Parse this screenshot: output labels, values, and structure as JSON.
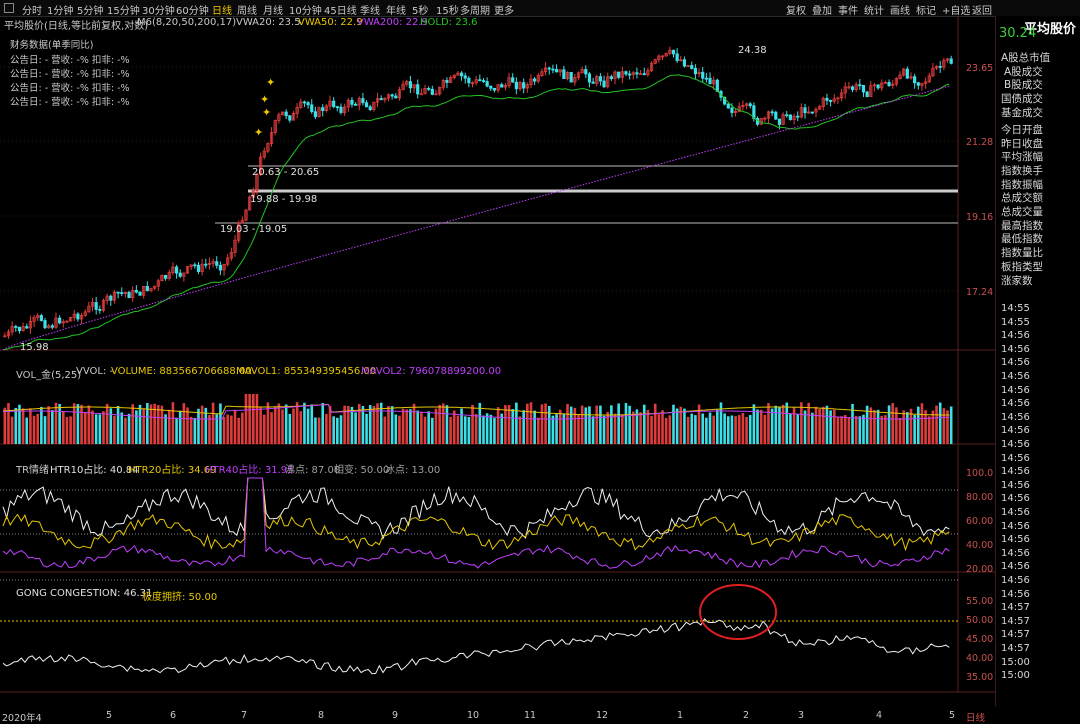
{
  "toolbar": {
    "periods": [
      "分时",
      "1分钟",
      "5分钟",
      "15分钟",
      "30分钟",
      "60分钟",
      "日线",
      "周线",
      "月线",
      "10分钟",
      "45日线",
      "季线",
      "年线",
      "5秒",
      "15秒",
      "多周期",
      "更多"
    ],
    "active": "日线",
    "right": [
      "复权",
      "叠加",
      "事件",
      "统计",
      "画线",
      "标记",
      "+自选",
      "返回"
    ]
  },
  "main": {
    "title": "平均股价(日线,等比前复权,对数)",
    "ma_label": "M6(8,20,50,200,17)",
    "vwa20": "VWA20: 23.5",
    "vwa50": "VWA50: 22.9",
    "vwa200": "VWA200: 22.9",
    "hold": "HOLD: 23.6",
    "finance_header": "财务数据(单季同比)",
    "finance_rows": [
      "公告日: -   营收: -%   扣非: -%",
      "公告日: -   营收: -%   扣非: -%",
      "公告日: -   营收: -%   扣非: -%",
      "公告日: -   营收: -%   扣非: -%"
    ],
    "price_levels": [
      "23.65",
      "21.28",
      "19.16",
      "17.24"
    ],
    "high_label": "24.38",
    "low_label": "15.98",
    "zones": [
      "20.63 - 20.65",
      "19.88 - 19.98",
      "19.03 - 19.05"
    ]
  },
  "volume": {
    "title": "VOL_金(5,25)",
    "vvol": "VVOL: -",
    "volume": "VOLUME: 883566706688.00",
    "mavol1": "MAVOL1: 855349395456.00",
    "mavol2": "MAVOL2: 796078899200.00"
  },
  "tr": {
    "title": "TR情绪",
    "htr10": "HTR10占比: 40.84",
    "htr20": "HTR20占比: 34.69",
    "htr40": "HTR40占比: 31.95",
    "boil": "沸点: 87.00",
    "phase": "相变: 50.00",
    "freeze": "冰点: 13.00",
    "levels": [
      "100.0",
      "80.00",
      "60.00",
      "40.00",
      "20.00"
    ]
  },
  "gong": {
    "title": "GONG CONGESTION: 46.31",
    "extreme": "极度拥挤: 50.00",
    "levels": [
      "55.00",
      "50.00",
      "45.00",
      "40.00",
      "35.00"
    ]
  },
  "xaxis": [
    "2020年4",
    "5",
    "6",
    "7",
    "8",
    "9",
    "10",
    "11",
    "12",
    "1",
    "2",
    "3",
    "4",
    "5"
  ],
  "xaxis_end": "日线",
  "right_panel": {
    "title": "平均股价",
    "price": "30.24",
    "items": [
      "A股总市值",
      "A股成交",
      "B股成交",
      "国债成交",
      "基金成交",
      "今日开盘",
      "昨日收盘",
      "平均涨幅",
      "指数换手",
      "指数振幅",
      "总成交额",
      "总成交量",
      "最高指数",
      "最低指数",
      "指数量比",
      "板指类型",
      "涨家数"
    ],
    "times": [
      "14:55",
      "14:55",
      "14:56",
      "14:56",
      "14:56",
      "14:56",
      "14:56",
      "14:56",
      "14:56",
      "14:56",
      "14:56",
      "14:56",
      "14:56",
      "14:56",
      "14:56",
      "14:56",
      "14:56",
      "14:56",
      "14:56",
      "14:56",
      "14:56",
      "14:56",
      "14:57",
      "14:57",
      "14:57",
      "14:57",
      "15:00",
      "15:00"
    ]
  },
  "colors": {
    "up": "#e03c3c",
    "down": "#3ce0e8",
    "ma": "#22c422",
    "vwa200": "#c040ff",
    "yellow": "#e8c800",
    "white": "#f0f0f0",
    "grid": "#4a1616"
  }
}
